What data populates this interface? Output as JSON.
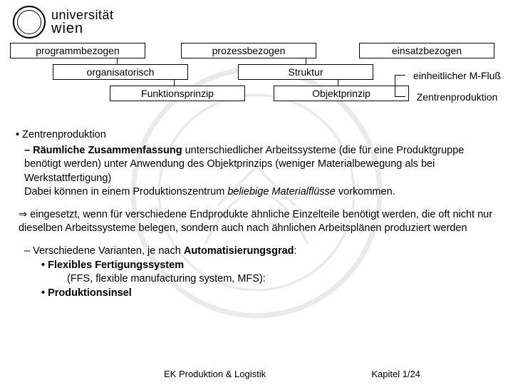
{
  "logo": {
    "line1": "universität",
    "line2": "wien"
  },
  "diagram": {
    "programm": "programmbezogen",
    "prozess": "prozessbezogen",
    "einsatz": "einsatzbezogen",
    "organisatorisch": "organisatorisch",
    "struktur": "Struktur",
    "funktionsprinzip": "Funktionsprinzip",
    "objektprinzip": "Objektprinzip",
    "mfluss": "einheitlicher M-Fluß",
    "zentren": "Zentrenproduktion"
  },
  "body": {
    "title": "• Zentrenproduktion",
    "p1_lead": "– Räumliche Zusammenfassung",
    "p1_rest": " unterschiedlicher Arbeitssysteme (die für eine Produktgruppe benötigt werden) unter Anwendung des Objektprinzips (weniger Materialbewegung als bei Werkstattfertigung)",
    "p1_line2a": "Dabei können in einem Produktionszentrum ",
    "p1_italic": "beliebige Materialflüsse",
    "p1_line2b": " vorkommen.",
    "p2": "⇒ eingesetzt, wenn für verschiedene Endprodukte ähnliche Einzelteile    benötigt werden, die oft nicht nur dieselben Arbeitssysteme belegen, sondern auch nach ähnlichen Arbeitsplänen produziert werden",
    "p3_lead": "–   Verschiedene Varianten, je nach ",
    "p3_bold": "Automatisierungsgrad",
    "p3_colon": ":",
    "flex_label": "• Flexibles Fertigungssystem",
    "flex_sub": "(FFS, flexible manufacturing system, MFS):",
    "insel": "• Produktionsinsel"
  },
  "footer": {
    "left": "EK Produktion & Logistik",
    "right": "Kapitel 1/24"
  }
}
